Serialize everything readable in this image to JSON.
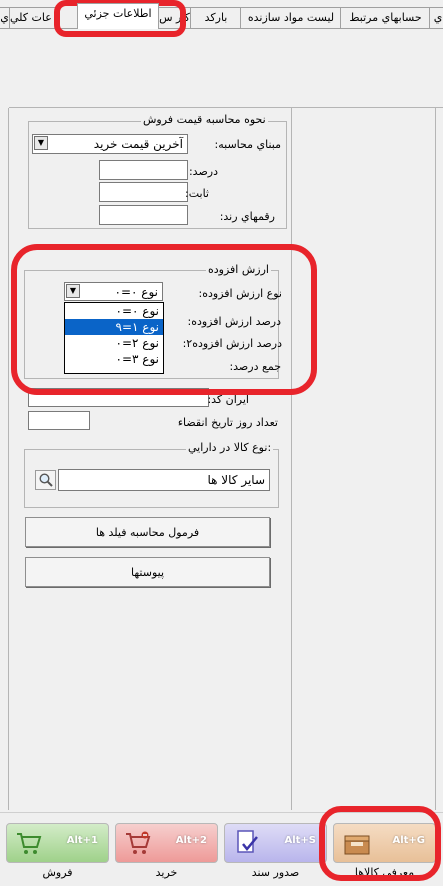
{
  "tabs": [
    "ي",
    "حسابهاي مرتبط",
    "ليست مواد سازنده",
    "بارکد",
    "کار س",
    "اطلاعات جزئي",
    "اط عات کلي"
  ],
  "active_tab": "اطلاعات جزئي",
  "price_group": {
    "title": "نحوه محاسبه قيمت فروش",
    "basis_label": "مبناي محاسبه:",
    "basis_value": "آخرين قيمت خريد",
    "percent_label": "درصد:",
    "fixed_label": "ثابت:",
    "rounding_label": "رقمهاي رند:"
  },
  "vat_group": {
    "title": "ارزش افزوده",
    "type_label": "نوع ارزش افزوده:",
    "type_value": "نوع ۰=۰",
    "percent_label": "درصد ارزش افزوده:",
    "percent2_label": "درصد ارزش افزوده۲:",
    "total_label": "جمع درصد:",
    "options": [
      "نوع ۰=۰",
      "نوع ۱=۹",
      "نوع ۲=۰",
      "نوع ۳=۰"
    ],
    "selected_index": 1
  },
  "iran_code_label": "ايران کد:",
  "expiry_days_label": "تعداد روز تاريخ انقضاء",
  "asset_group": {
    "title": "نوع کالا در دارايي:",
    "value": "ساير کالا ها"
  },
  "buttons": {
    "field_formula": "فرمول محاسبه فيلد ها",
    "attachments": "پيوستها"
  },
  "toolbar": [
    {
      "caption": "فروش",
      "shortcut": "Alt+1",
      "color": "#9fd18a",
      "icon": "cart-icon"
    },
    {
      "caption": "خريد",
      "shortcut": "Alt+2",
      "color": "#ee9a98",
      "icon": "cart-minus-icon"
    },
    {
      "caption": "صدور سند",
      "shortcut": "Alt+S",
      "color": "#b9b5ec",
      "icon": "document-check-icon"
    },
    {
      "caption": "معرفي کالاها",
      "shortcut": "Alt+G",
      "color": "#e8c098",
      "icon": "box-icon"
    }
  ],
  "colors": {
    "highlight": "#e8242b",
    "selection": "#0a64c8"
  }
}
